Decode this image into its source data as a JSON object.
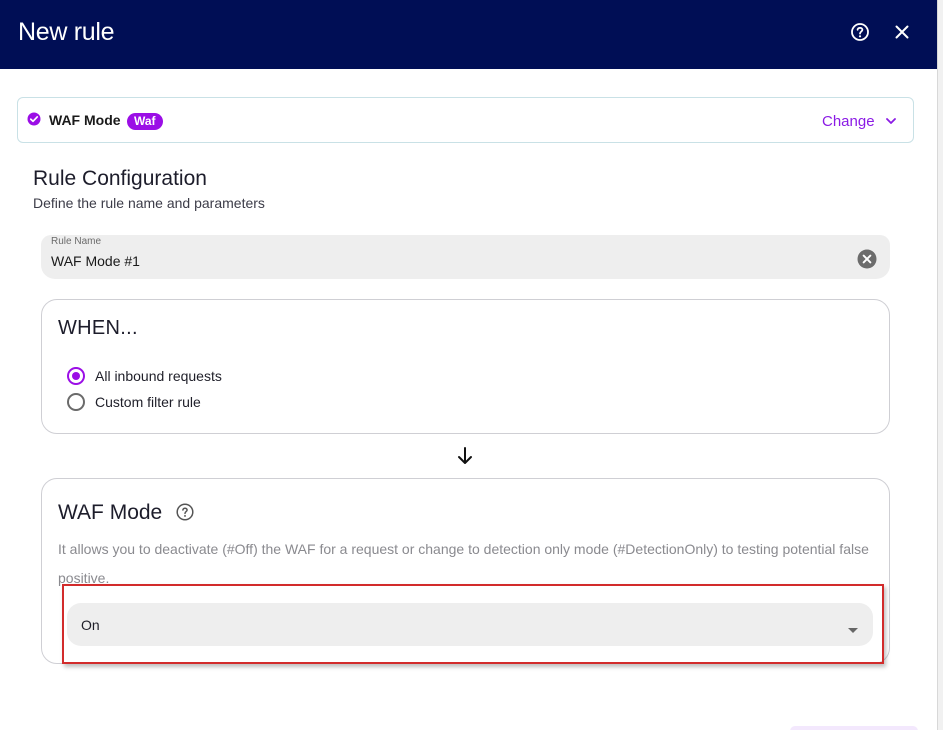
{
  "dialog": {
    "title": "New rule",
    "help_icon": "help-circle-icon",
    "close_icon": "close-icon"
  },
  "action": {
    "name": "WAF Mode",
    "badge": "Waf",
    "change_label": "Change",
    "check_icon": "check-circle-icon"
  },
  "config": {
    "title": "Rule Configuration",
    "subtitle": "Define the rule name and parameters",
    "rule_name_label": "Rule Name",
    "rule_name_value": "WAF Mode #1"
  },
  "when": {
    "title": "WHEN...",
    "options": [
      {
        "label": "All inbound requests",
        "checked": true
      },
      {
        "label": "Custom filter rule",
        "checked": false
      }
    ]
  },
  "waf": {
    "title": "WAF Mode",
    "description": "It allows you to deactivate (#Off) the WAF for a request or change to detection only mode (#DetectionOnly) to testing potential false positive.",
    "selected_value": "On"
  },
  "colors": {
    "header_bg": "#000e55",
    "accent": "#9b0ee6",
    "highlight": "#d22b2b"
  }
}
